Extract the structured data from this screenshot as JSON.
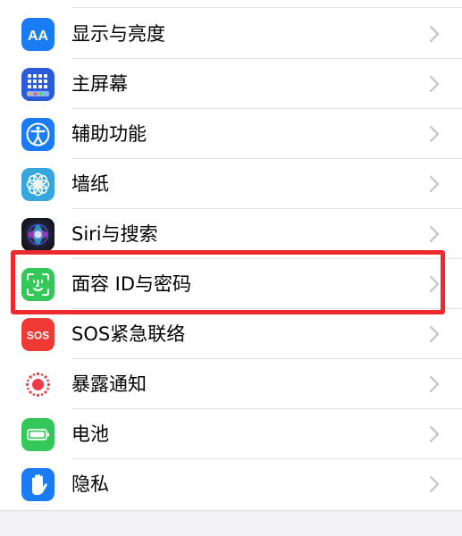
{
  "settings": {
    "items": [
      {
        "label": "显示与亮度",
        "icon": "display-brightness-icon",
        "color": "#1a7cf5"
      },
      {
        "label": "主屏幕",
        "icon": "home-screen-icon",
        "color": "#2b5bd9"
      },
      {
        "label": "辅助功能",
        "icon": "accessibility-icon",
        "color": "#1a7cf5"
      },
      {
        "label": "墙纸",
        "icon": "wallpaper-icon",
        "color": "#36a7de"
      },
      {
        "label": "Siri与搜索",
        "icon": "siri-icon",
        "color": "#1b1b2e"
      },
      {
        "label": "面容 ID与密码",
        "icon": "face-id-icon",
        "color": "#34c759"
      },
      {
        "label": "SOS紧急联络",
        "icon": "sos-icon",
        "color": "#ef3a33",
        "badge": "SOS"
      },
      {
        "label": "暴露通知",
        "icon": "exposure-notification-icon",
        "color": "#ffffff"
      },
      {
        "label": "电池",
        "icon": "battery-icon",
        "color": "#34c759"
      },
      {
        "label": "隐私",
        "icon": "privacy-hand-icon",
        "color": "#1a7cf5"
      }
    ]
  },
  "highlight": {
    "item": "面容 ID与密码",
    "color": "#ee2a2d"
  }
}
